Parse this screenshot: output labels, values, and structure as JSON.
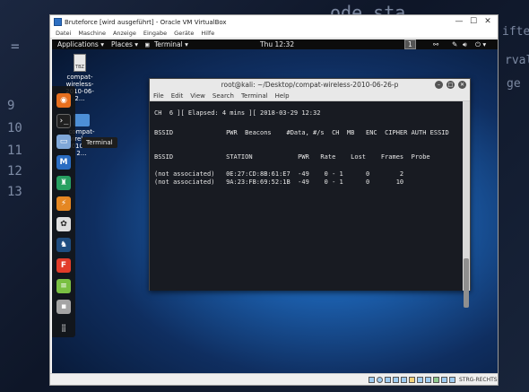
{
  "host": {
    "code_snippets": [
      "ode_sta",
      "9",
      "10",
      "11",
      "12",
      "13",
      "=",
      "ifte",
      "rval",
      "ge"
    ]
  },
  "vbox": {
    "title": "Bruteforce [wird ausgeführt] - Oracle VM VirtualBox",
    "menu": [
      "Datei",
      "Maschine",
      "Anzeige",
      "Eingabe",
      "Geräte",
      "Hilfe"
    ],
    "host_key_label": "STRG-RECHTS"
  },
  "kali_topbar": {
    "applications": "Applications ▾",
    "places": "Places ▾",
    "terminal": "Terminal ▾",
    "clock": "Thu 12:32",
    "workspace": "1"
  },
  "desktop": {
    "icon1_label": "compat-wireless-2010-06-2...",
    "icon2_label": "compat-wireless-2010-06-2...",
    "tooltip": "Terminal"
  },
  "terminal": {
    "title": "root@kali: ~/Desktop/compat-wireless-2010-06-26-p",
    "menu": [
      "File",
      "Edit",
      "View",
      "Search",
      "Terminal",
      "Help"
    ],
    "lines": [
      "CH  6 ][ Elapsed: 4 mins ][ 2018-03-29 12:32",
      "BSSID              PWR  Beacons    #Data, #/s  CH  MB   ENC  CIPHER AUTH ESSID",
      "BSSID              STATION            PWR   Rate    Lost    Frames  Probe",
      "(not associated)   0E:27:CD:8B:61:E7  -49    0 - 1      0        2",
      "(not associated)   9A:23:FB:69:52:1B  -49    0 - 1      0       10"
    ]
  }
}
